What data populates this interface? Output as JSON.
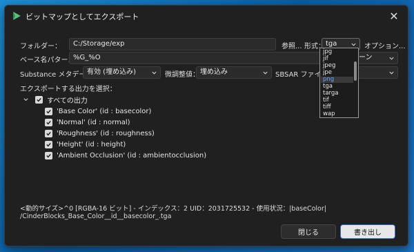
{
  "window": {
    "title": "ビットマップとしてエクスポート",
    "close_glyph": "✕"
  },
  "folder": {
    "label": "フォルダー：",
    "value": "C:/Storage/exp",
    "browse_label": "参照...",
    "format_label": "形式：",
    "format_value": "tga",
    "options_label": "オプション..."
  },
  "basename": {
    "label": "ベース名パターン：",
    "value": "%G_%O",
    "right_combo_visible_text": "ーン"
  },
  "metadata": {
    "label": "Substance メタデータ：",
    "value": "有効 (埋め込み)",
    "adjust_label": "微調整値：",
    "adjust_value": "埋め込み",
    "sbsar_label": "SBSAR ファイル："
  },
  "outputs": {
    "heading": "エクスポートする出力を選択：",
    "all_label": "すべての出力",
    "items": [
      "'Base Color' (id : basecolor)",
      "'Normal' (id : normal)",
      "'Roughness' (id : roughness)",
      "'Height' (id : height)",
      "'Ambient Occlusion' (id : ambientocclusion)"
    ]
  },
  "info": {
    "line1": "<動的サイズ>^0 [RGBA-16 ビット] - インデックス：2 UID：2031725532 - 使用状況：|baseColor|",
    "line2": "/CinderBlocks_Base_Color__id__basecolor_.tga"
  },
  "footer": {
    "close_label": "閉じる",
    "export_label": "書き出し"
  },
  "format_dropdown": {
    "options": [
      "jpg",
      "jif",
      "jpeg",
      "jpe",
      "png",
      "tga",
      "targa",
      "tif",
      "tiff",
      "wap"
    ],
    "highlighted": "png"
  },
  "colors": {
    "accent": "#1c6fd6",
    "dialog_bg": "#202020",
    "checkbox": "#d9d9d9"
  }
}
